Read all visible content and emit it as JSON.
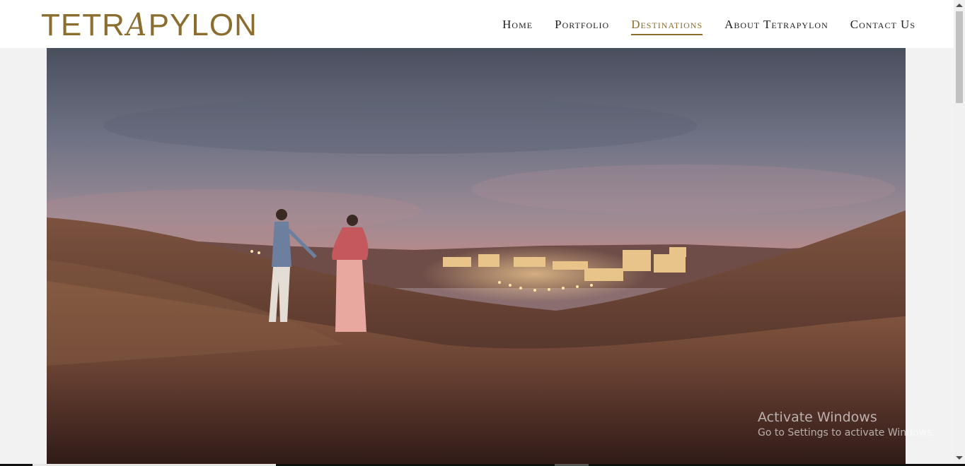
{
  "brand": {
    "logo_pre": "TETR",
    "logo_a": "A",
    "logo_post": "PYLON",
    "color": "#8b6d2e"
  },
  "nav": {
    "items": [
      {
        "label": "Home",
        "active": false
      },
      {
        "label": "Portfolio",
        "active": false
      },
      {
        "label": "Destinations",
        "active": true
      },
      {
        "label": "About Tetrapylon",
        "active": false
      },
      {
        "label": "Contact Us",
        "active": false
      }
    ]
  },
  "hero": {
    "image": "desert-dunes-couple-at-dusk-photo"
  },
  "watermark": {
    "title": "Activate Windows",
    "subtitle": "Go to Settings to activate Windows."
  }
}
